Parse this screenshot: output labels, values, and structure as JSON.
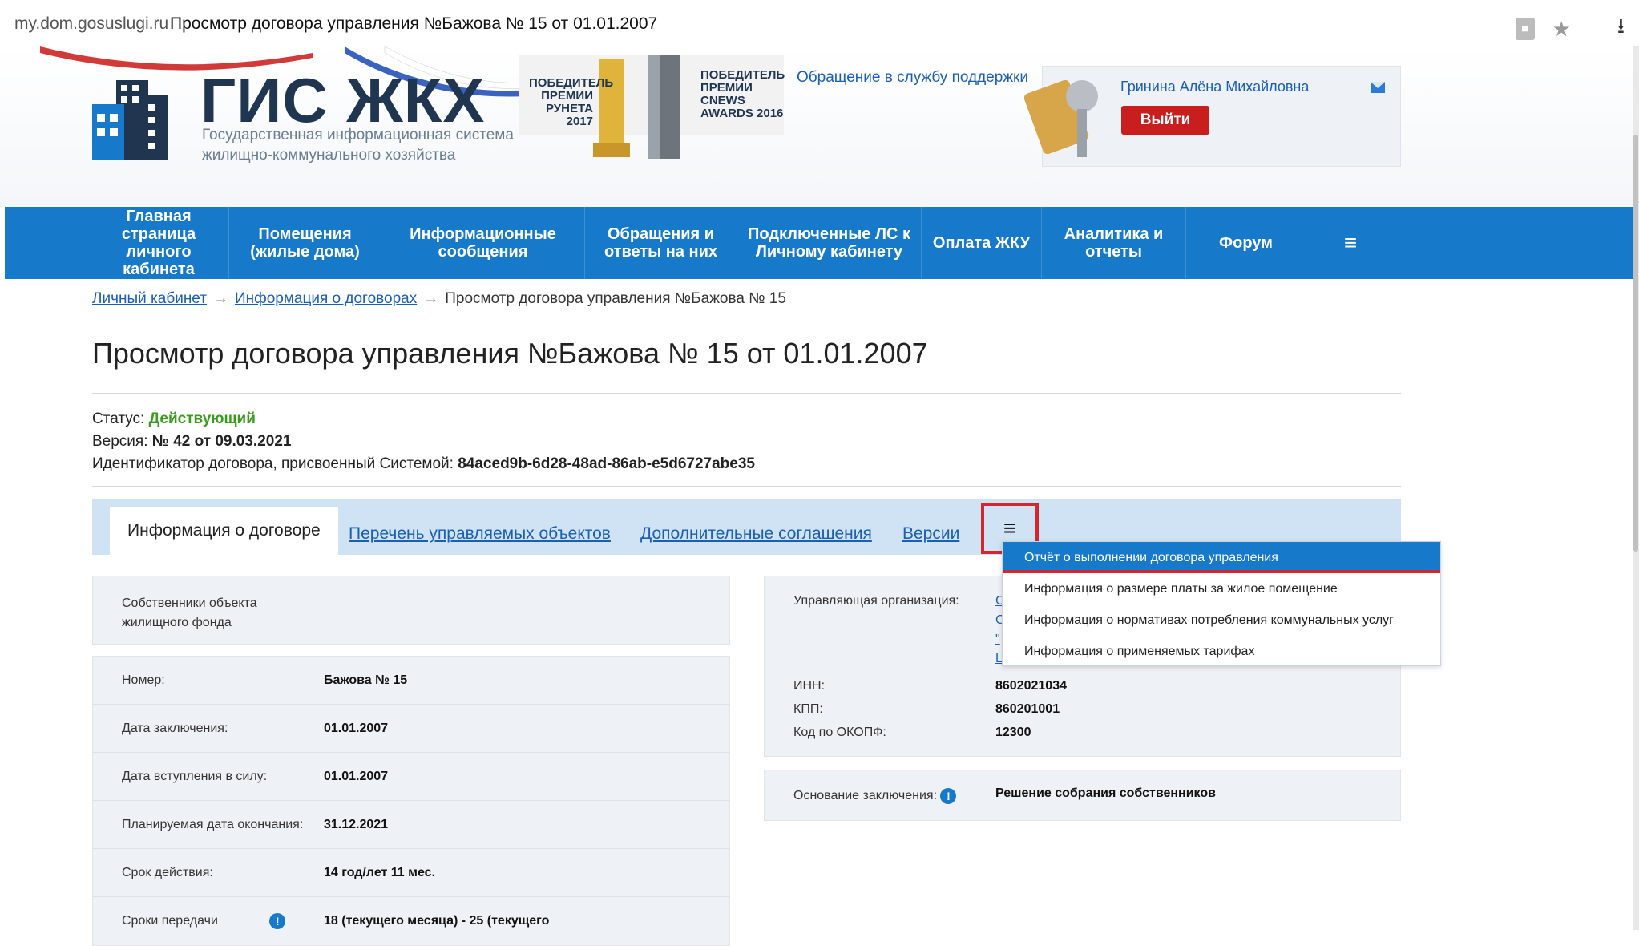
{
  "browser": {
    "domain": "my.dom.gosuslugi.ru",
    "tab_title": "Просмотр договора управления №Бажова № 15 от 01.01.2007"
  },
  "header": {
    "logo_title": "ГИС ЖКХ",
    "logo_subtitle_1": "Государственная информационная система",
    "logo_subtitle_2": "жилищно-коммунального хозяйства",
    "award1_text": [
      "ПОБЕДИТЕЛЬ",
      "ПРЕМИИ",
      "РУНЕТА 2017"
    ],
    "award2_text": [
      "ПОБЕДИТЕЛЬ",
      "ПРЕМИИ",
      "CNEWS",
      "AWARDS 2016"
    ],
    "support_link": "Обращение в службу поддержки",
    "user_name": "Гринина Алёна Михайловна",
    "logout_label": "Выйти"
  },
  "nav": {
    "items": [
      {
        "label": "Главная страница личного кабинета"
      },
      {
        "label": "Помещения (жилые дома)"
      },
      {
        "label": "Информационные сообщения"
      },
      {
        "label": "Обращения и ответы на них"
      },
      {
        "label": "Подключенные ЛС к Личному кабинету"
      },
      {
        "label": "Оплата ЖКУ"
      },
      {
        "label": "Аналитика и отчеты"
      },
      {
        "label": "Форум"
      }
    ],
    "menu_icon": "≡"
  },
  "breadcrumb": {
    "item1": "Личный кабинет",
    "item2": "Информация о договорах",
    "current": "Просмотр договора управления №Бажова № 15",
    "separator": "→"
  },
  "page_title": "Просмотр договора управления №Бажова № 15 от 01.01.2007",
  "info": {
    "status_label": "Статус:",
    "status_value": "Действующий",
    "version_label": "Версия:",
    "version_value": "№ 42 от 09.03.2021",
    "id_label": "Идентификатор договора, присвоенный Системой:",
    "id_value": "84aced9b-6d28-48ad-86ab-e5d6727abe35"
  },
  "tabs": {
    "active": "Информация о договоре",
    "tab2": "Перечень управляемых объектов",
    "tab3": "Дополнительные соглашения",
    "tab4": "Версии",
    "menu_icon": "≡"
  },
  "dropdown": {
    "items": [
      "Отчёт о выполнении договора управления",
      "Информация о размере платы за жилое помещение",
      "Информация о нормативах потребления коммунальных услуг",
      "Информация о применяемых тарифах"
    ]
  },
  "left_panel": {
    "owners_label_1": "Собственники объекта",
    "owners_label_2": "жилищного фонда",
    "rows": [
      {
        "label": "Номер:",
        "value": "Бажова № 15"
      },
      {
        "label": "Дата заключения:",
        "value": "01.01.2007"
      },
      {
        "label": "Дата вступления в силу:",
        "value": "01.01.2007"
      },
      {
        "label": "Планируемая дата окончания:",
        "value": "31.12.2021"
      },
      {
        "label": "Срок действия:",
        "value": "14 год/лет 11 мес."
      },
      {
        "label": "Сроки передачи",
        "value": "18 (текущего месяца) - 25 (текущего"
      }
    ]
  },
  "right_panel": {
    "org_label": "Управляющая организация:",
    "inn_label": "ИНН:",
    "inn_value": "8602021034",
    "kpp_label": "КПП:",
    "kpp_value": "860201001",
    "okopf_label": "Код по ОКОПФ:",
    "okopf_value": "12300",
    "basis_label": "Основание заключения:",
    "basis_value": "Решение собрания собственников",
    "info_icon": "!"
  },
  "colors": {
    "nav_blue": "#1779c9",
    "status_green": "#3a9b1f",
    "highlight_red": "#d3262e",
    "tabs_bg": "#cfe3f5"
  }
}
